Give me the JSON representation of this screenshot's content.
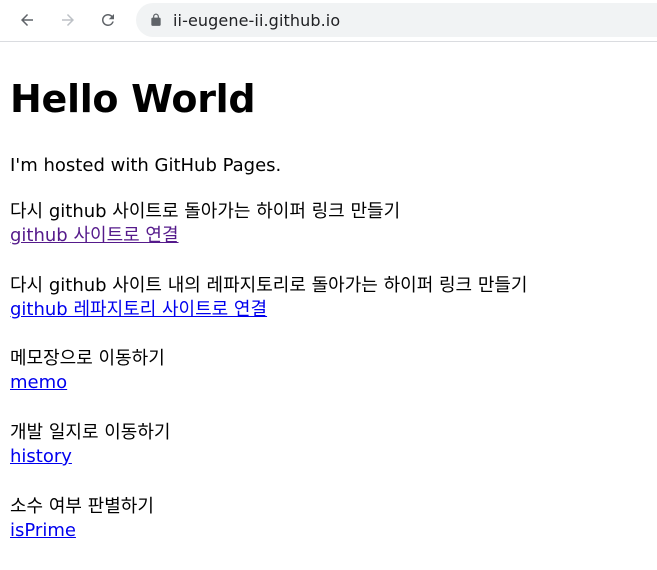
{
  "browser": {
    "url": "ii-eugene-ii.github.io",
    "icons": {
      "back": "back-arrow-icon",
      "forward": "forward-arrow-icon",
      "reload": "reload-icon",
      "lock": "lock-icon"
    }
  },
  "page": {
    "title": "Hello World",
    "intro": "I'm hosted with GitHub Pages.",
    "sections": [
      {
        "description": "다시 github 사이트로 돌아가는 하이퍼 링크 만들기",
        "link": "github 사이트로 연결"
      },
      {
        "description": "다시 github 사이트 내의 레파지토리로 돌아가는 하이퍼 링크 만들기",
        "link": "github 레파지토리 사이트로 연결"
      },
      {
        "description": "메모장으로 이동하기",
        "link": "memo"
      },
      {
        "description": "개발 일지로 이동하기",
        "link": "history"
      },
      {
        "description": "소수 여부 판별하기",
        "link": "isPrime"
      }
    ]
  },
  "colors": {
    "link": "#0000ee",
    "visited_link": "#551a8b",
    "omnibox": "#f1f3f4"
  }
}
